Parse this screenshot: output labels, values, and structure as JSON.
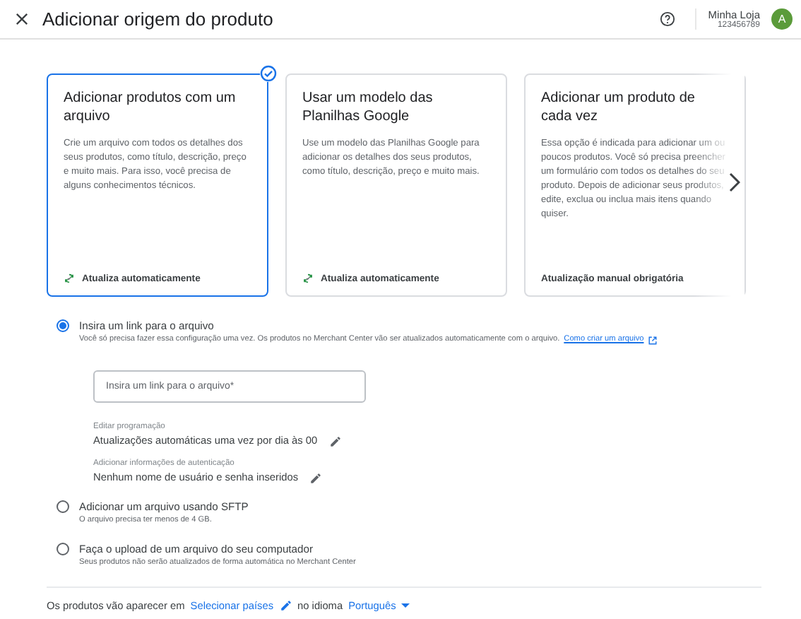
{
  "header": {
    "title": "Adicionar origem do produto",
    "account_name": "Minha Loja",
    "account_id": "123456789",
    "avatar": "A"
  },
  "cards": [
    {
      "title": "Adicionar produtos com um arquivo",
      "description": "Crie um arquivo com todos os detalhes dos seus produtos, como título, descrição, preço e muito mais. Para isso, você precisa de alguns conhecimentos técnicos.",
      "footer": "Atualiza automaticamente",
      "kind": "auto",
      "selected": true
    },
    {
      "title": "Usar um modelo das Planilhas Google",
      "description": "Use um modelo das Planilhas Google para adicionar os detalhes dos seus produtos, como título, descrição, preço e muito mais.",
      "footer": "Atualiza automaticamente",
      "kind": "auto",
      "selected": false
    },
    {
      "title": "Adicionar um produto de cada vez",
      "description": "Essa opção é indicada para adicionar um ou poucos produtos. Você só precisa preencher um formulário com todos os detalhes do seu produto. Depois de adicionar seus produtos, edite, exclua ou inclua mais itens quando quiser.",
      "footer": "Atualização manual obrigatória",
      "kind": "manual",
      "selected": false
    }
  ],
  "options": [
    {
      "label": "Insira um link para o arquivo",
      "description": "Você só precisa fazer essa configuração uma vez. Os produtos no Merchant Center vão ser atualizados automaticamente com o arquivo.",
      "link": "Como criar um arquivo",
      "selected": true,
      "input": {
        "placeholder": "Insira um link para o arquivo*"
      },
      "settings": [
        {
          "label": "Editar programação",
          "value": "Atualizações automáticas uma vez por dia às 00"
        },
        {
          "label": "Adicionar informações de autenticação",
          "value": "Nenhum nome de usuário e senha inseridos"
        }
      ]
    },
    {
      "label": "Adicionar um arquivo usando SFTP",
      "description": "O arquivo precisa ter menos de 4 GB.",
      "selected": false
    },
    {
      "label": "Faça o upload de um arquivo do seu computador",
      "description": "Seus produtos não serão atualizados de forma automática no Merchant Center",
      "selected": false
    }
  ],
  "footer": {
    "prefix": "Os produtos vão aparecer em",
    "countries": "Selecionar países",
    "middle": "no idioma",
    "language": "Português"
  }
}
